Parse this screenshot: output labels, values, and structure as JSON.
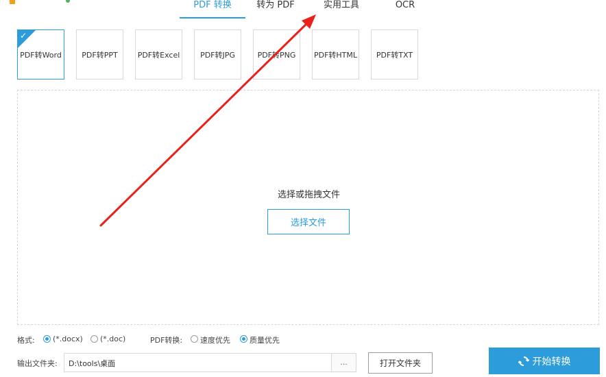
{
  "nav": {
    "tabs": [
      {
        "label": "PDF 转换",
        "active": true
      },
      {
        "label": "转为 PDF",
        "active": false
      },
      {
        "label": "实用工具",
        "active": false
      },
      {
        "label": "OCR",
        "active": false
      }
    ]
  },
  "cards": [
    {
      "label": "PDF转Word",
      "selected": true
    },
    {
      "label": "PDF转PPT",
      "selected": false
    },
    {
      "label": "PDF转Excel",
      "selected": false
    },
    {
      "label": "PDF转JPG",
      "selected": false
    },
    {
      "label": "PDF转PNG",
      "selected": false
    },
    {
      "label": "PDF转HTML",
      "selected": false
    },
    {
      "label": "PDF转TXT",
      "selected": false
    }
  ],
  "dropzone": {
    "prompt": "选择或拖拽文件",
    "button": "选择文件"
  },
  "options": {
    "format_label": "格式:",
    "format_docx": "(*.docx)",
    "format_doc": "(*.doc)",
    "format_selected": "docx",
    "mode_label": "PDF转换:",
    "mode_speed": "速度优先",
    "mode_quality": "质量优先",
    "mode_selected": "quality"
  },
  "output": {
    "label": "输出文件夹:",
    "path": "D:\\tools\\桌面",
    "browse": "...",
    "open_folder": "打开文件夹"
  },
  "start_button": "开始转换",
  "colors": {
    "accent": "#2d9cdb",
    "annotation_arrow": "#e8221b"
  }
}
